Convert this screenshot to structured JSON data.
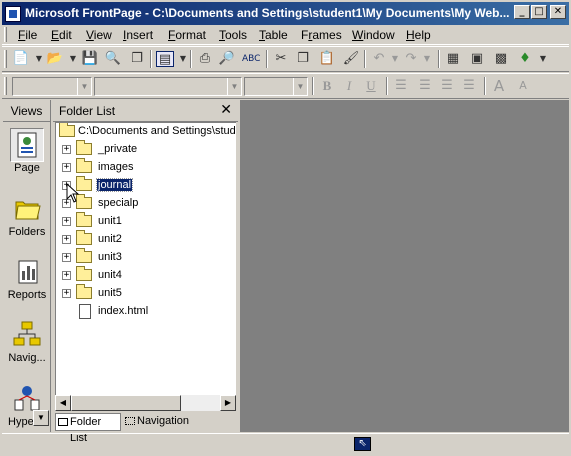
{
  "window": {
    "title": "Microsoft FrontPage - C:\\Documents and Settings\\student1\\My Documents\\My Web...",
    "controls": {
      "minimize": "_",
      "maximize": "□",
      "close": "✕"
    }
  },
  "menubar": {
    "items": [
      {
        "label": "File",
        "u": "F",
        "rest": "ile"
      },
      {
        "label": "Edit",
        "u": "E",
        "rest": "dit"
      },
      {
        "label": "View",
        "u": "V",
        "rest": "iew"
      },
      {
        "label": "Insert",
        "u": "I",
        "rest": "nsert"
      },
      {
        "label": "Format",
        "u": "F",
        "rest": "ormat"
      },
      {
        "label": "Tools",
        "u": "T",
        "rest": "ools"
      },
      {
        "label": "Table",
        "u": "T",
        "rest": "able"
      },
      {
        "label": "Frames",
        "u": "r",
        "pre": "F",
        "rest": "ames"
      },
      {
        "label": "Window",
        "u": "W",
        "rest": "indow"
      },
      {
        "label": "Help",
        "u": "H",
        "rest": "elp"
      }
    ]
  },
  "toolbar_icons": {
    "standard": [
      "new-page-icon",
      "open-icon",
      "save-icon",
      "publish-icon",
      "folder-list-icon",
      "print-icon",
      "print-preview-icon",
      "spelling-icon",
      "cut-icon",
      "copy-icon",
      "paste-icon",
      "format-painter-icon",
      "undo-icon",
      "redo-icon",
      "web-component-icon",
      "insert-table-icon",
      "insert-picture-icon"
    ],
    "formatting": [
      "bold-icon",
      "italic-icon",
      "underline-icon",
      "align-left-icon",
      "center-icon",
      "align-right-icon",
      "justify-icon",
      "increase-font-icon"
    ]
  },
  "formatting": {
    "bold": "B",
    "italic": "I",
    "underline": "U"
  },
  "views": {
    "heading": "Views",
    "items": [
      {
        "label": "Page",
        "icon": "page-view-icon",
        "selected": true
      },
      {
        "label": "Folders",
        "icon": "folders-view-icon",
        "selected": false
      },
      {
        "label": "Reports",
        "icon": "reports-view-icon",
        "selected": false
      },
      {
        "label": "Navig...",
        "icon": "navigation-view-icon",
        "selected": false
      },
      {
        "label": "Hyper...",
        "icon": "hyperlinks-view-icon",
        "selected": false
      }
    ]
  },
  "folder_list": {
    "heading": "Folder List",
    "close": "✕",
    "root": "C:\\Documents and Settings\\stude",
    "items": [
      {
        "name": "_private",
        "type": "folder",
        "selected": false
      },
      {
        "name": "images",
        "type": "folder",
        "selected": false
      },
      {
        "name": "journal",
        "type": "folder",
        "selected": true
      },
      {
        "name": "specialp",
        "type": "folder",
        "selected": false
      },
      {
        "name": "unit1",
        "type": "folder",
        "selected": false
      },
      {
        "name": "unit2",
        "type": "folder",
        "selected": false
      },
      {
        "name": "unit3",
        "type": "folder",
        "selected": false
      },
      {
        "name": "unit4",
        "type": "folder",
        "selected": false
      },
      {
        "name": "unit5",
        "type": "folder",
        "selected": false
      },
      {
        "name": "index.html",
        "type": "file",
        "selected": false
      }
    ],
    "tabs": [
      {
        "label": "Folder List",
        "active": true
      },
      {
        "label": "Navigation",
        "active": false
      }
    ]
  }
}
